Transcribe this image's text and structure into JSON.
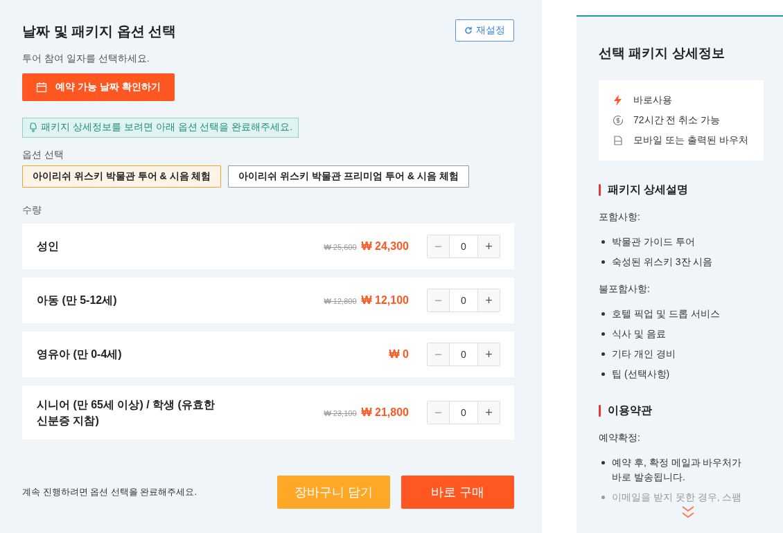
{
  "header": {
    "title": "날짜 및 패키지 옵션 선택",
    "reset_button": "재설정"
  },
  "date": {
    "prompt": "투어 참여 일자를 선택하세요.",
    "button": "예약 가능 날짜 확인하기"
  },
  "notice": "패키지 상세정보를 보려면 아래 옵션 선택을 완료해주세요.",
  "options": {
    "label": "옵션 선택",
    "items": [
      {
        "label": "아이리쉬 위스키 박물관 투어 & 시음 체험",
        "selected": true
      },
      {
        "label": "아이리쉬 위스키 박물관 프리미엄 투어 & 시음 체험",
        "selected": false
      }
    ]
  },
  "quantity": {
    "label": "수량",
    "rows": [
      {
        "name": "성인",
        "original_price": "₩ 25,600",
        "price": "₩ 24,300",
        "minus": "−",
        "value": "0",
        "plus": "+",
        "minus_disabled": true
      },
      {
        "name": "아동 (만 5-12세)",
        "original_price": "₩ 12,800",
        "price": "₩ 12,100",
        "minus": "−",
        "value": "0",
        "plus": "+",
        "minus_disabled": true
      },
      {
        "name": "영유아 (만 0-4세)",
        "price": "₩ 0",
        "minus": "−",
        "value": "0",
        "plus": "+",
        "minus_disabled": true
      },
      {
        "name": "시니어 (만 65세 이상) / 학생 (유효한 신분증 지참)",
        "original_price": "₩ 23,100",
        "price": "₩ 21,800",
        "minus": "−",
        "value": "0",
        "plus": "+",
        "minus_disabled": true
      }
    ]
  },
  "footer": {
    "hint": "계속 진행하려면 옵션 선택을 완료해주세요.",
    "cart_button": "장바구니 담기",
    "buy_button": "바로 구매"
  },
  "details": {
    "title": "선택 패키지 상세정보",
    "features": [
      {
        "kind": "instant",
        "text": "바로사용"
      },
      {
        "kind": "refund",
        "text": "72시간 전 취소 가능"
      },
      {
        "kind": "voucher",
        "text": "모바일 또는 출력된 바우처"
      }
    ],
    "sections": [
      {
        "title": "패키지 상세설명",
        "groups": [
          {
            "label": "포함사항:",
            "items": [
              {
                "text": "박물관 가이드 투어",
                "faded": false
              },
              {
                "text": "숙성된 위스키 3잔 시음",
                "faded": false
              }
            ]
          },
          {
            "label": "불포함사항:",
            "items": [
              {
                "text": "호텔 픽업 및 드롭 서비스",
                "faded": false
              },
              {
                "text": "식사 및 음료",
                "faded": false
              },
              {
                "text": "기타 개인 경비",
                "faded": false
              },
              {
                "text": "팁 (선택사항)",
                "faded": false
              }
            ]
          }
        ]
      },
      {
        "title": "이용약관",
        "groups": [
          {
            "label": "예약확정:",
            "items": [
              {
                "text": "예약 후, 확정 메일과 바우처가 바로 발송됩니다.",
                "faded": false
              },
              {
                "text": "이메일을 받지 못한 경우, 스팸",
                "faded": true
              }
            ]
          }
        ]
      }
    ]
  }
}
